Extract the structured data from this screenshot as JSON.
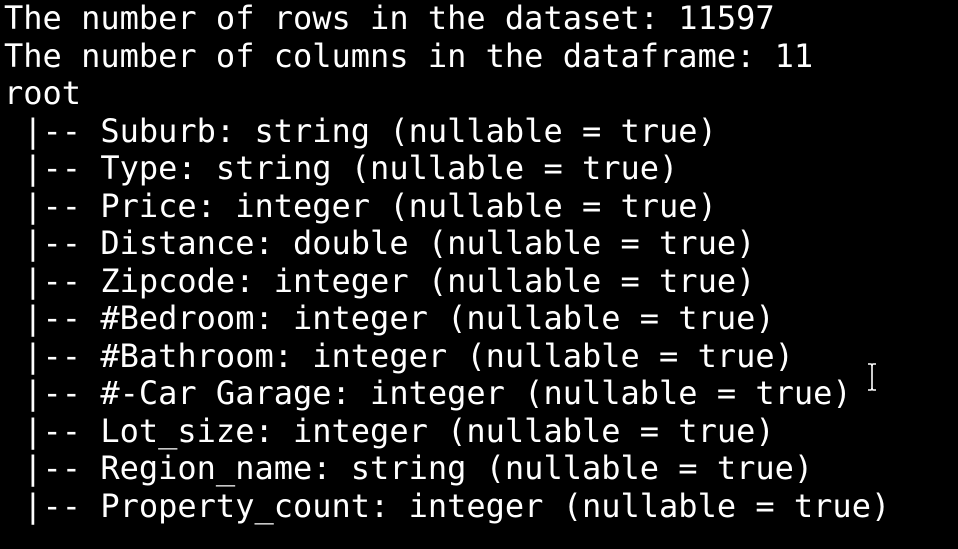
{
  "terminal": {
    "lines": [
      "The number of rows in the dataset: 11597",
      "The number of columns in the dataframe: 11",
      "root",
      " |-- Suburb: string (nullable = true)",
      " |-- Type: string (nullable = true)",
      " |-- Price: integer (nullable = true)",
      " |-- Distance: double (nullable = true)",
      " |-- Zipcode: integer (nullable = true)",
      " |-- #Bedroom: integer (nullable = true)",
      " |-- #Bathroom: integer (nullable = true)",
      " |-- #-Car Garage: integer (nullable = true)",
      " |-- Lot_size: integer (nullable = true)",
      " |-- Region_name: string (nullable = true)",
      " |-- Property_count: integer (nullable = true)"
    ],
    "background": "#000000",
    "foreground": "#ffffff",
    "cursor_icon": "i-beam-cursor-icon"
  }
}
